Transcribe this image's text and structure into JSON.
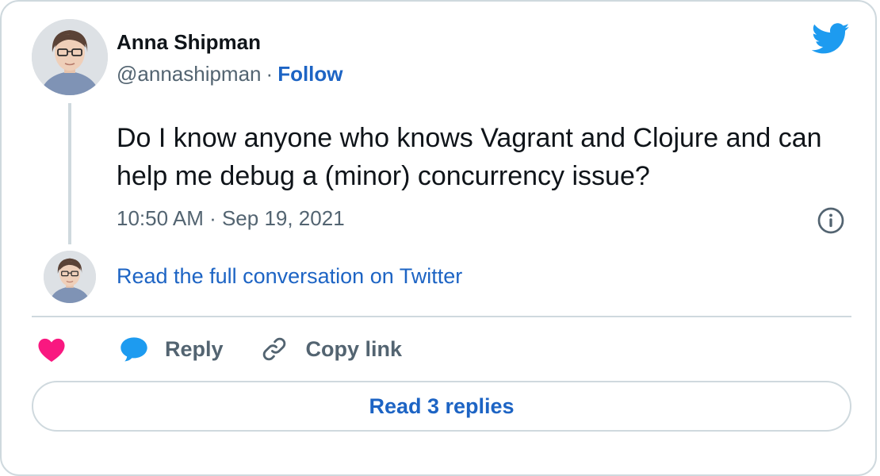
{
  "author": {
    "name": "Anna Shipman",
    "handle": "@annashipman",
    "separator": "·",
    "follow_label": "Follow"
  },
  "tweet": {
    "text": "Do I know anyone who knows Vagrant and Clojure and can help me debug a (minor) concurrency issue?",
    "timestamp": "10:50 AM · Sep 19, 2021"
  },
  "conversation_link": "Read the full conversation on Twitter",
  "actions": {
    "reply_label": "Reply",
    "copy_link_label": "Copy link"
  },
  "read_replies_label": "Read 3 replies",
  "colors": {
    "link_blue": "#1d64c4",
    "twitter_blue": "#1d9bf0",
    "heart_pink": "#f91880",
    "muted_text": "#536471",
    "border": "#cfd9de"
  },
  "icons": [
    "twitter-bird-icon",
    "info-icon",
    "heart-icon",
    "reply-bubble-icon",
    "link-icon"
  ]
}
